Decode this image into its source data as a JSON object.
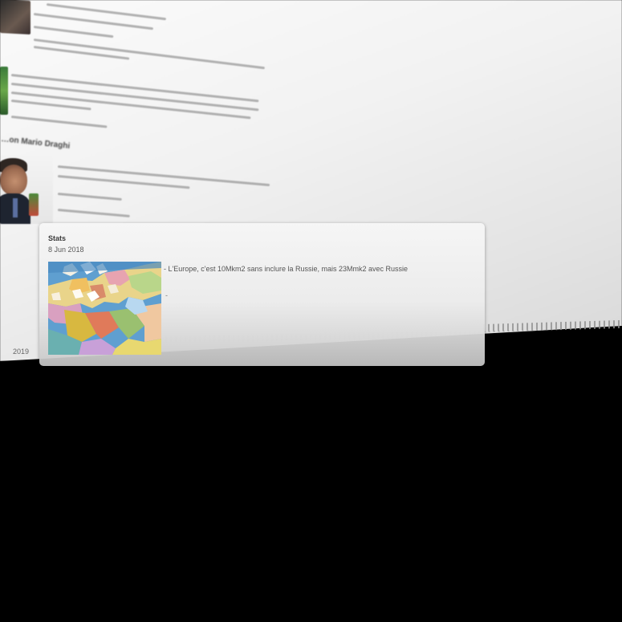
{
  "card": {
    "title": "Stats",
    "date": "8 Jun 2018",
    "text": "- L'Europe, c'est 10Mkm2 sans inclure la Russie, mais 23Mmk2 avec Russie",
    "extra": "-",
    "image_icon": "europe-map-photo"
  },
  "background": {
    "heading": "…on Mario Draghi",
    "year": "2019"
  },
  "colors": {
    "backdrop": "#000000",
    "page": "#f2f2f2",
    "card": "#ececec"
  }
}
